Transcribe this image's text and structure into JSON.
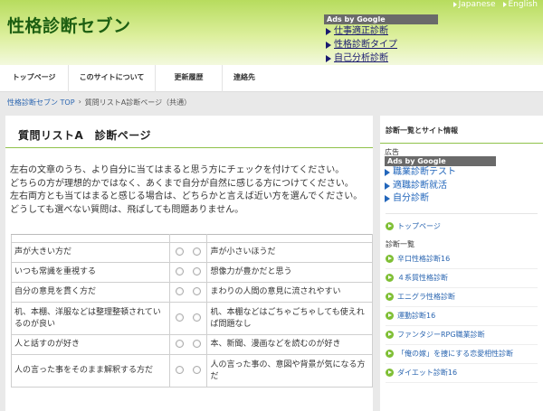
{
  "header": {
    "site_title": "性格診断セブン",
    "languages": [
      {
        "label": "Japanese"
      },
      {
        "label": "English"
      }
    ]
  },
  "ads_top": {
    "label": "Ads by Google",
    "links": [
      "仕事適正診断",
      "性格診断タイプ",
      "自己分析診断"
    ]
  },
  "nav": {
    "items": [
      "トップページ",
      "このサイトについて",
      "更新履歴",
      "連絡先"
    ]
  },
  "breadcrumb": {
    "home": "性格診断セブン TOP",
    "separator": "›",
    "current": "質問リストA診断ページ（共通）"
  },
  "main": {
    "heading": "質問リストA　診断ページ",
    "intro": [
      "左右の文章のうち、より自分に当てはまると思う方にチェックを付けてください。",
      "どちらの方が理想的かではなく、あくまで自分が自然に感じる方につけてください。",
      "左右両方とも当てはまると感じる場合は、どちらかと言えば近い方を選んでください。",
      "どうしても選べない質問は、飛ばしても問題ありません。"
    ],
    "questions": [
      {
        "left": "声が大きい方だ",
        "right": "声が小さいほうだ"
      },
      {
        "left": "いつも常識を重視する",
        "right": "想像力が豊かだと思う"
      },
      {
        "left": "自分の意見を貫く方だ",
        "right": "まわりの人間の意見に流されやすい"
      },
      {
        "left": "机、本棚、洋服などは整理整頓されているのが良い",
        "right": "机、本棚などはごちゃごちゃしても使えれば問題なし"
      },
      {
        "left": "人と話すのが好き",
        "right": "本、新聞、漫画などを読むのが好き"
      },
      {
        "left": "人の言った事をそのまま解釈する方だ",
        "right": "人の言った事の、意図や背景が気になる方だ"
      }
    ]
  },
  "sidebar": {
    "heading": "診断一覧とサイト情報",
    "ad_heading": "広告",
    "ads_label": "Ads by Google",
    "ad_links": [
      "職業診断テスト",
      "適職診断就活",
      "自分診断"
    ],
    "top_link": "トップページ",
    "section_label": "診断一覧",
    "diagnoses": [
      "辛口性格診断16",
      "４系質性格診断",
      "エニグラ性格診断",
      "運動診断16",
      "ファンタジーRPG職業診断",
      "「俺の嫁」を捜にする恋愛相性診断",
      "ダイエット診断16"
    ]
  }
}
